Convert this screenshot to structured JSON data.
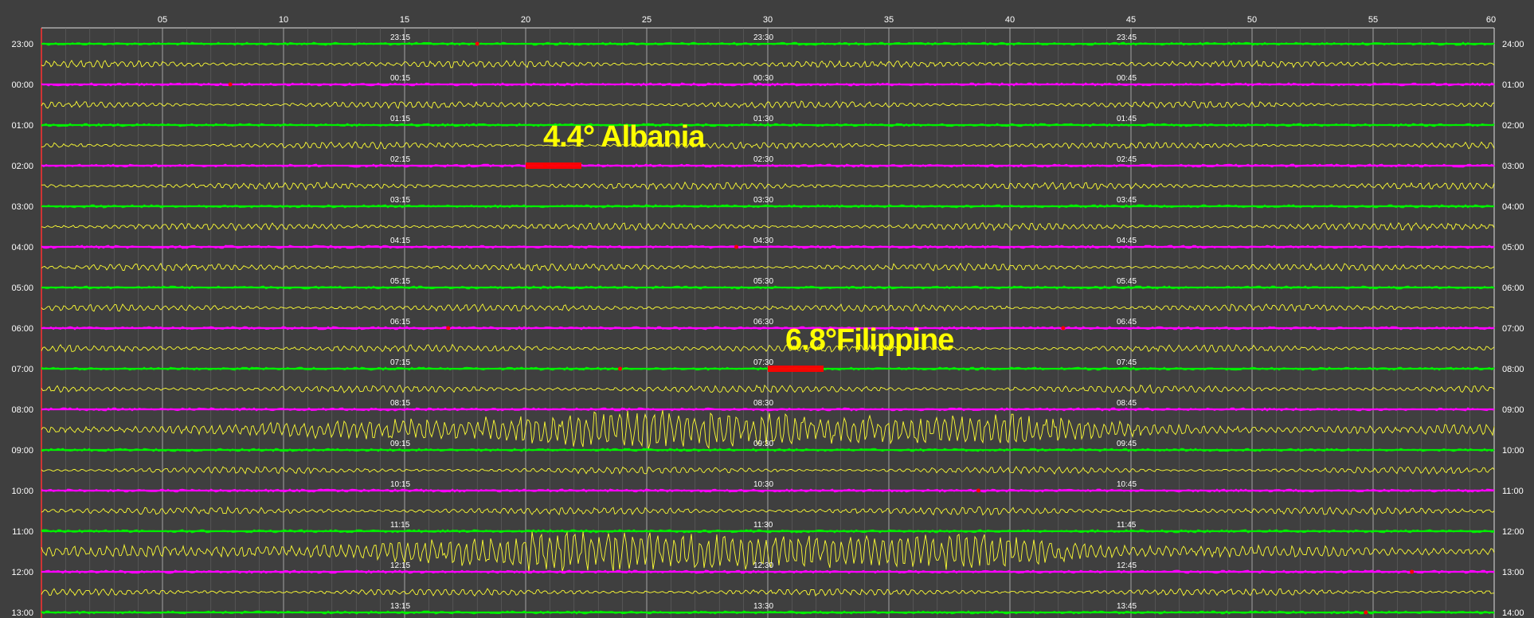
{
  "chart_data": {
    "type": "line",
    "top_minutes": [
      "05",
      "10",
      "15",
      "20",
      "25",
      "30",
      "35",
      "40",
      "45",
      "50",
      "55",
      "60"
    ],
    "rows": [
      {
        "left": "23:00",
        "right": "24:00",
        "q1": "23:15",
        "q2": "23:30",
        "q3": "23:45",
        "color": "#00ee00",
        "activity": 0.2
      },
      {
        "left": "00:00",
        "right": "01:00",
        "q1": "00:15",
        "q2": "00:30",
        "q3": "00:45",
        "color": "#ff00ff",
        "activity": 0.15
      },
      {
        "left": "01:00",
        "right": "02:00",
        "q1": "01:15",
        "q2": "01:30",
        "q3": "01:45",
        "color": "#00ee00",
        "activity": 0.15
      },
      {
        "left": "02:00",
        "right": "03:00",
        "q1": "02:15",
        "q2": "02:30",
        "q3": "02:45",
        "color": "#ff00ff",
        "activity": 0.2
      },
      {
        "left": "03:00",
        "right": "04:00",
        "q1": "03:15",
        "q2": "03:30",
        "q3": "03:45",
        "color": "#00ee00",
        "activity": 0.25
      },
      {
        "left": "04:00",
        "right": "05:00",
        "q1": "04:15",
        "q2": "04:30",
        "q3": "04:45",
        "color": "#ff00ff",
        "activity": 0.2
      },
      {
        "left": "05:00",
        "right": "06:00",
        "q1": "05:15",
        "q2": "05:30",
        "q3": "05:45",
        "color": "#00ee00",
        "activity": 0.2
      },
      {
        "left": "06:00",
        "right": "07:00",
        "q1": "06:15",
        "q2": "06:30",
        "q3": "06:45",
        "color": "#ff00ff",
        "activity": 0.25
      },
      {
        "left": "07:00",
        "right": "08:00",
        "q1": "07:15",
        "q2": "07:30",
        "q3": "07:45",
        "color": "#00ee00",
        "activity": 0.3
      },
      {
        "left": "08:00",
        "right": "09:00",
        "q1": "08:15",
        "q2": "08:30",
        "q3": "08:45",
        "color": "#ff00ff",
        "activity": 0.9
      },
      {
        "left": "09:00",
        "right": "10:00",
        "q1": "09:15",
        "q2": "09:30",
        "q3": "09:45",
        "color": "#00ee00",
        "activity": 0.2
      },
      {
        "left": "10:00",
        "right": "11:00",
        "q1": "10:15",
        "q2": "10:30",
        "q3": "10:45",
        "color": "#ff00ff",
        "activity": 0.3
      },
      {
        "left": "11:00",
        "right": "12:00",
        "q1": "11:15",
        "q2": "11:30",
        "q3": "11:45",
        "color": "#00ee00",
        "activity": 1.0
      },
      {
        "left": "12:00",
        "right": "13:00",
        "q1": "12:15",
        "q2": "12:30",
        "q3": "12:45",
        "color": "#ff00ff",
        "activity": 0.2
      },
      {
        "left": "13:00",
        "right": "14:00",
        "q1": "13:15",
        "q2": "13:30",
        "q3": "13:45",
        "color": "#00ee00",
        "activity": 0.2
      }
    ],
    "events": [
      {
        "label": "4.4° Albania",
        "row": 3,
        "minute": 20
      },
      {
        "label": "6.8°Filippine",
        "row": 8,
        "minute": 30
      }
    ],
    "trace_color": "#ffff33",
    "grid_color": "#d0d0d0",
    "label_color": "#ffffff",
    "event_label_color": "#ffff00",
    "marker_color": "#ff0000"
  }
}
